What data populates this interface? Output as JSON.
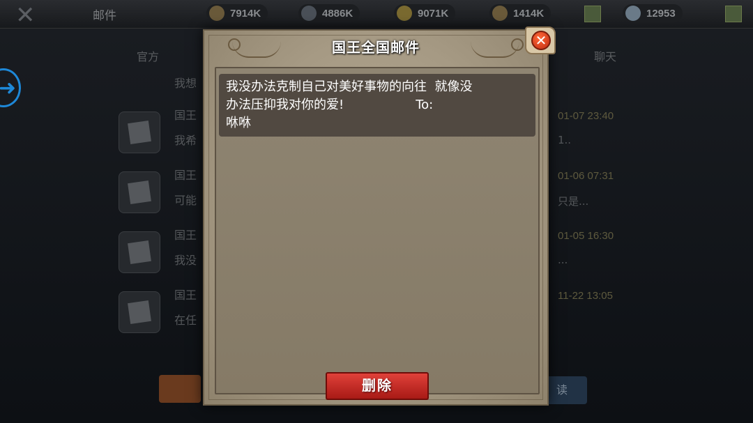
{
  "topbar": {
    "title": "邮件",
    "resources": [
      {
        "icon": "wood-icon",
        "value": "7914K",
        "color": "#6a5a3a"
      },
      {
        "icon": "iron-icon",
        "value": "4886K",
        "color": "#4a5058"
      },
      {
        "icon": "food-icon",
        "value": "9071K",
        "color": "#7a6a30"
      },
      {
        "icon": "stone-icon",
        "value": "1414K",
        "color": "#6a5a3a"
      },
      {
        "icon": "gem-icon",
        "value": "12953",
        "color": "#6a7a88"
      }
    ]
  },
  "background": {
    "tabs": [
      "官方",
      "聊天"
    ],
    "mails": [
      {
        "sender": "",
        "preview": "我想",
        "date": "",
        "extra": ""
      },
      {
        "sender": "国王",
        "preview": "我希",
        "date": "01-07  23:40",
        "extra": "1.."
      },
      {
        "sender": "国王",
        "preview": "可能",
        "date": "01-06  07:31",
        "extra": "只是..."
      },
      {
        "sender": "国王",
        "preview": "我没",
        "date": "01-05  16:30",
        "extra": "..."
      },
      {
        "sender": "国王",
        "preview": "在任",
        "date": "11-22  13:05",
        "extra": ""
      }
    ],
    "read_button": "读"
  },
  "dialog": {
    "title": "国王全国邮件",
    "message": "我没办法克制自己对美好事物的向往  就像没\n办法压抑我对你的爱!                  To:\n咻咻",
    "delete_label": "删除",
    "close_symbol": "✕"
  }
}
